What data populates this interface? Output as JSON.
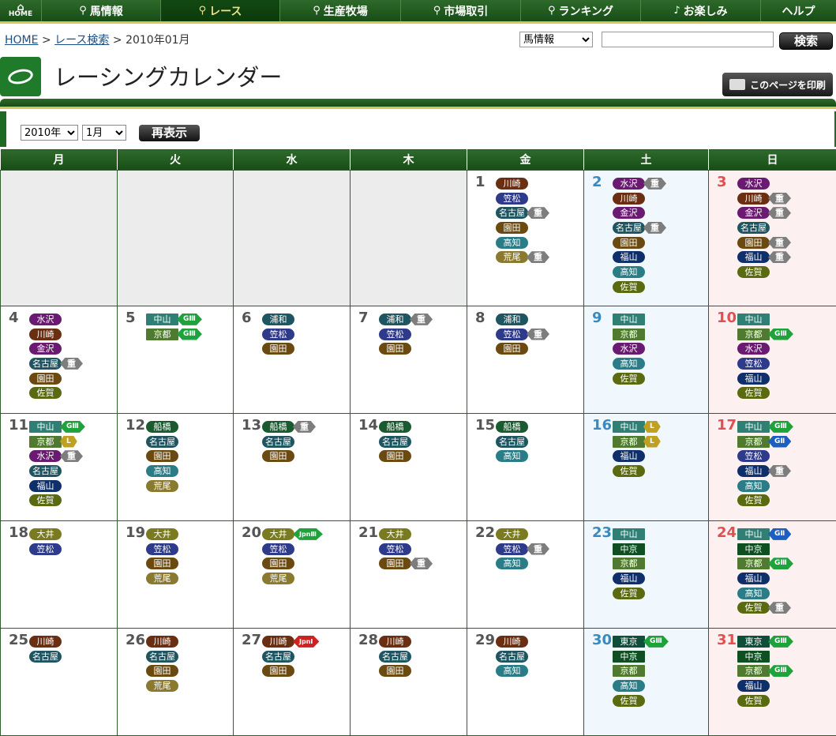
{
  "nav": {
    "items": [
      {
        "label": "HOME",
        "icon": "home-icon"
      },
      {
        "label": "馬情報",
        "icon": "search-icon"
      },
      {
        "label": "レース",
        "icon": "search-icon",
        "active": true
      },
      {
        "label": "生産牧場",
        "icon": "search-icon"
      },
      {
        "label": "市場取引",
        "icon": "search-icon"
      },
      {
        "label": "ランキング",
        "icon": "search-icon"
      },
      {
        "label": "お楽しみ",
        "icon": "music-note-icon"
      },
      {
        "label": "ヘルプ",
        "icon": ""
      }
    ]
  },
  "breadcrumb": {
    "home": "HOME",
    "sep1": ">",
    "race_search": "レース検索",
    "sep2": ">",
    "current": "2010年01月"
  },
  "search": {
    "select_value": "馬情報",
    "input_value": "",
    "button_label": "検索"
  },
  "page": {
    "title": "レーシングカレンダー",
    "print_label": "このページを印刷"
  },
  "controls": {
    "year": "2010年",
    "month": "1月",
    "redisplay_label": "再表示"
  },
  "colors": {
    "header_green": "#1f5f1d",
    "gold_accent": "#d8c45a",
    "saturday_bg": "#f0f8fe",
    "sunday_bg": "#fdf0f0",
    "heavy_badge": "#7d7d7d",
    "g3_badge": "#1fa13c",
    "g2_badge": "#1c5fc0",
    "listed_badge": "#c0a020",
    "jpn1_badge": "#d02020"
  },
  "venue_colors": {
    "川崎": "#6a2f12",
    "笠松": "#2e3a8a",
    "名古屋": "#1f5560",
    "園田": "#6a4a10",
    "高知": "#2a7d86",
    "荒尾": "#8a7a30",
    "水沢": "#6a1a70",
    "金沢": "#6a1a70",
    "福山": "#0f2f6a",
    "佐賀": "#5a6a10",
    "浦和": "#1f5560",
    "船橋": "#1a5a30",
    "大井": "#7a7a20",
    "中山": "#2f7f75",
    "京都": "#4f7a2f",
    "中京": "#0f4f22",
    "東京": "#0f4f3a"
  },
  "calendar": {
    "weekdays": [
      "月",
      "火",
      "水",
      "木",
      "金",
      "土",
      "日"
    ],
    "weeks": [
      [
        null,
        null,
        null,
        null,
        {
          "day": "1",
          "races": [
            {
              "venue": "川崎"
            },
            {
              "venue": "笠松"
            },
            {
              "venue": "名古屋",
              "badge": "重"
            },
            {
              "venue": "園田"
            },
            {
              "venue": "高知"
            },
            {
              "venue": "荒尾",
              "badge": "重"
            }
          ]
        },
        {
          "day": "2",
          "races": [
            {
              "venue": "水沢",
              "badge": "重"
            },
            {
              "venue": "川崎"
            },
            {
              "venue": "金沢"
            },
            {
              "venue": "名古屋",
              "badge": "重"
            },
            {
              "venue": "園田"
            },
            {
              "venue": "福山"
            },
            {
              "venue": "高知"
            },
            {
              "venue": "佐賀"
            }
          ]
        },
        {
          "day": "3",
          "races": [
            {
              "venue": "水沢"
            },
            {
              "venue": "川崎",
              "badge": "重"
            },
            {
              "venue": "金沢",
              "badge": "重"
            },
            {
              "venue": "名古屋"
            },
            {
              "venue": "園田",
              "badge": "重"
            },
            {
              "venue": "福山",
              "badge": "重"
            },
            {
              "venue": "佐賀"
            }
          ]
        }
      ],
      [
        {
          "day": "4",
          "races": [
            {
              "venue": "水沢"
            },
            {
              "venue": "川崎"
            },
            {
              "venue": "金沢"
            },
            {
              "venue": "名古屋",
              "badge": "重"
            },
            {
              "venue": "園田"
            },
            {
              "venue": "佐賀"
            }
          ]
        },
        {
          "day": "5",
          "races": [
            {
              "venue": "中山",
              "badge": "GⅢ"
            },
            {
              "venue": "京都",
              "badge": "GⅢ"
            }
          ]
        },
        {
          "day": "6",
          "races": [
            {
              "venue": "浦和"
            },
            {
              "venue": "笠松"
            },
            {
              "venue": "園田"
            }
          ]
        },
        {
          "day": "7",
          "races": [
            {
              "venue": "浦和",
              "badge": "重"
            },
            {
              "venue": "笠松"
            },
            {
              "venue": "園田"
            }
          ]
        },
        {
          "day": "8",
          "races": [
            {
              "venue": "浦和"
            },
            {
              "venue": "笠松",
              "badge": "重"
            },
            {
              "venue": "園田"
            }
          ]
        },
        {
          "day": "9",
          "races": [
            {
              "venue": "中山"
            },
            {
              "venue": "京都"
            },
            {
              "venue": "水沢"
            },
            {
              "venue": "高知"
            },
            {
              "venue": "佐賀"
            }
          ]
        },
        {
          "day": "10",
          "races": [
            {
              "venue": "中山"
            },
            {
              "venue": "京都",
              "badge": "GⅢ"
            },
            {
              "venue": "水沢"
            },
            {
              "venue": "笠松"
            },
            {
              "venue": "福山"
            },
            {
              "venue": "佐賀"
            }
          ]
        }
      ],
      [
        {
          "day": "11",
          "races": [
            {
              "venue": "中山",
              "badge": "GⅢ"
            },
            {
              "venue": "京都",
              "badge": "L"
            },
            {
              "venue": "水沢",
              "badge": "重"
            },
            {
              "venue": "名古屋"
            },
            {
              "venue": "福山"
            },
            {
              "venue": "佐賀"
            }
          ]
        },
        {
          "day": "12",
          "races": [
            {
              "venue": "船橋"
            },
            {
              "venue": "名古屋"
            },
            {
              "venue": "園田"
            },
            {
              "venue": "高知"
            },
            {
              "venue": "荒尾"
            }
          ]
        },
        {
          "day": "13",
          "races": [
            {
              "venue": "船橋",
              "badge": "重"
            },
            {
              "venue": "名古屋"
            },
            {
              "venue": "園田"
            }
          ]
        },
        {
          "day": "14",
          "races": [
            {
              "venue": "船橋"
            },
            {
              "venue": "名古屋"
            },
            {
              "venue": "園田"
            }
          ]
        },
        {
          "day": "15",
          "races": [
            {
              "venue": "船橋"
            },
            {
              "venue": "名古屋"
            },
            {
              "venue": "高知"
            }
          ]
        },
        {
          "day": "16",
          "races": [
            {
              "venue": "中山",
              "badge": "L"
            },
            {
              "venue": "京都",
              "badge": "L"
            },
            {
              "venue": "福山"
            },
            {
              "venue": "佐賀"
            }
          ]
        },
        {
          "day": "17",
          "races": [
            {
              "venue": "中山",
              "badge": "GⅢ"
            },
            {
              "venue": "京都",
              "badge": "GⅡ"
            },
            {
              "venue": "笠松"
            },
            {
              "venue": "福山",
              "badge": "重"
            },
            {
              "venue": "高知"
            },
            {
              "venue": "佐賀"
            }
          ]
        }
      ],
      [
        {
          "day": "18",
          "races": [
            {
              "venue": "大井"
            },
            {
              "venue": "笠松"
            }
          ]
        },
        {
          "day": "19",
          "races": [
            {
              "venue": "大井"
            },
            {
              "venue": "笠松"
            },
            {
              "venue": "園田"
            },
            {
              "venue": "荒尾"
            }
          ]
        },
        {
          "day": "20",
          "races": [
            {
              "venue": "大井",
              "badge": "JpnⅢ"
            },
            {
              "venue": "笠松"
            },
            {
              "venue": "園田"
            },
            {
              "venue": "荒尾"
            }
          ]
        },
        {
          "day": "21",
          "races": [
            {
              "venue": "大井"
            },
            {
              "venue": "笠松"
            },
            {
              "venue": "園田",
              "badge": "重"
            }
          ]
        },
        {
          "day": "22",
          "races": [
            {
              "venue": "大井"
            },
            {
              "venue": "笠松",
              "badge": "重"
            },
            {
              "venue": "高知"
            }
          ]
        },
        {
          "day": "23",
          "races": [
            {
              "venue": "中山"
            },
            {
              "venue": "中京"
            },
            {
              "venue": "京都"
            },
            {
              "venue": "福山"
            },
            {
              "venue": "佐賀"
            }
          ]
        },
        {
          "day": "24",
          "races": [
            {
              "venue": "中山",
              "badge": "GⅡ"
            },
            {
              "venue": "中京"
            },
            {
              "venue": "京都",
              "badge": "GⅢ"
            },
            {
              "venue": "福山"
            },
            {
              "venue": "高知"
            },
            {
              "venue": "佐賀",
              "badge": "重"
            }
          ]
        }
      ],
      [
        {
          "day": "25",
          "races": [
            {
              "venue": "川崎"
            },
            {
              "venue": "名古屋"
            }
          ]
        },
        {
          "day": "26",
          "races": [
            {
              "venue": "川崎"
            },
            {
              "venue": "名古屋"
            },
            {
              "venue": "園田"
            },
            {
              "venue": "荒尾"
            }
          ]
        },
        {
          "day": "27",
          "races": [
            {
              "venue": "川崎",
              "badge": "JpnⅠ"
            },
            {
              "venue": "名古屋"
            },
            {
              "venue": "園田"
            }
          ]
        },
        {
          "day": "28",
          "races": [
            {
              "venue": "川崎"
            },
            {
              "venue": "名古屋"
            },
            {
              "venue": "園田"
            }
          ]
        },
        {
          "day": "29",
          "races": [
            {
              "venue": "川崎"
            },
            {
              "venue": "名古屋"
            },
            {
              "venue": "高知"
            }
          ]
        },
        {
          "day": "30",
          "races": [
            {
              "venue": "東京",
              "badge": "GⅢ"
            },
            {
              "venue": "中京"
            },
            {
              "venue": "京都"
            },
            {
              "venue": "高知"
            },
            {
              "venue": "佐賀"
            }
          ]
        },
        {
          "day": "31",
          "races": [
            {
              "venue": "東京",
              "badge": "GⅢ"
            },
            {
              "venue": "中京"
            },
            {
              "venue": "京都",
              "badge": "GⅢ"
            },
            {
              "venue": "福山"
            },
            {
              "venue": "佐賀"
            }
          ]
        }
      ]
    ]
  }
}
